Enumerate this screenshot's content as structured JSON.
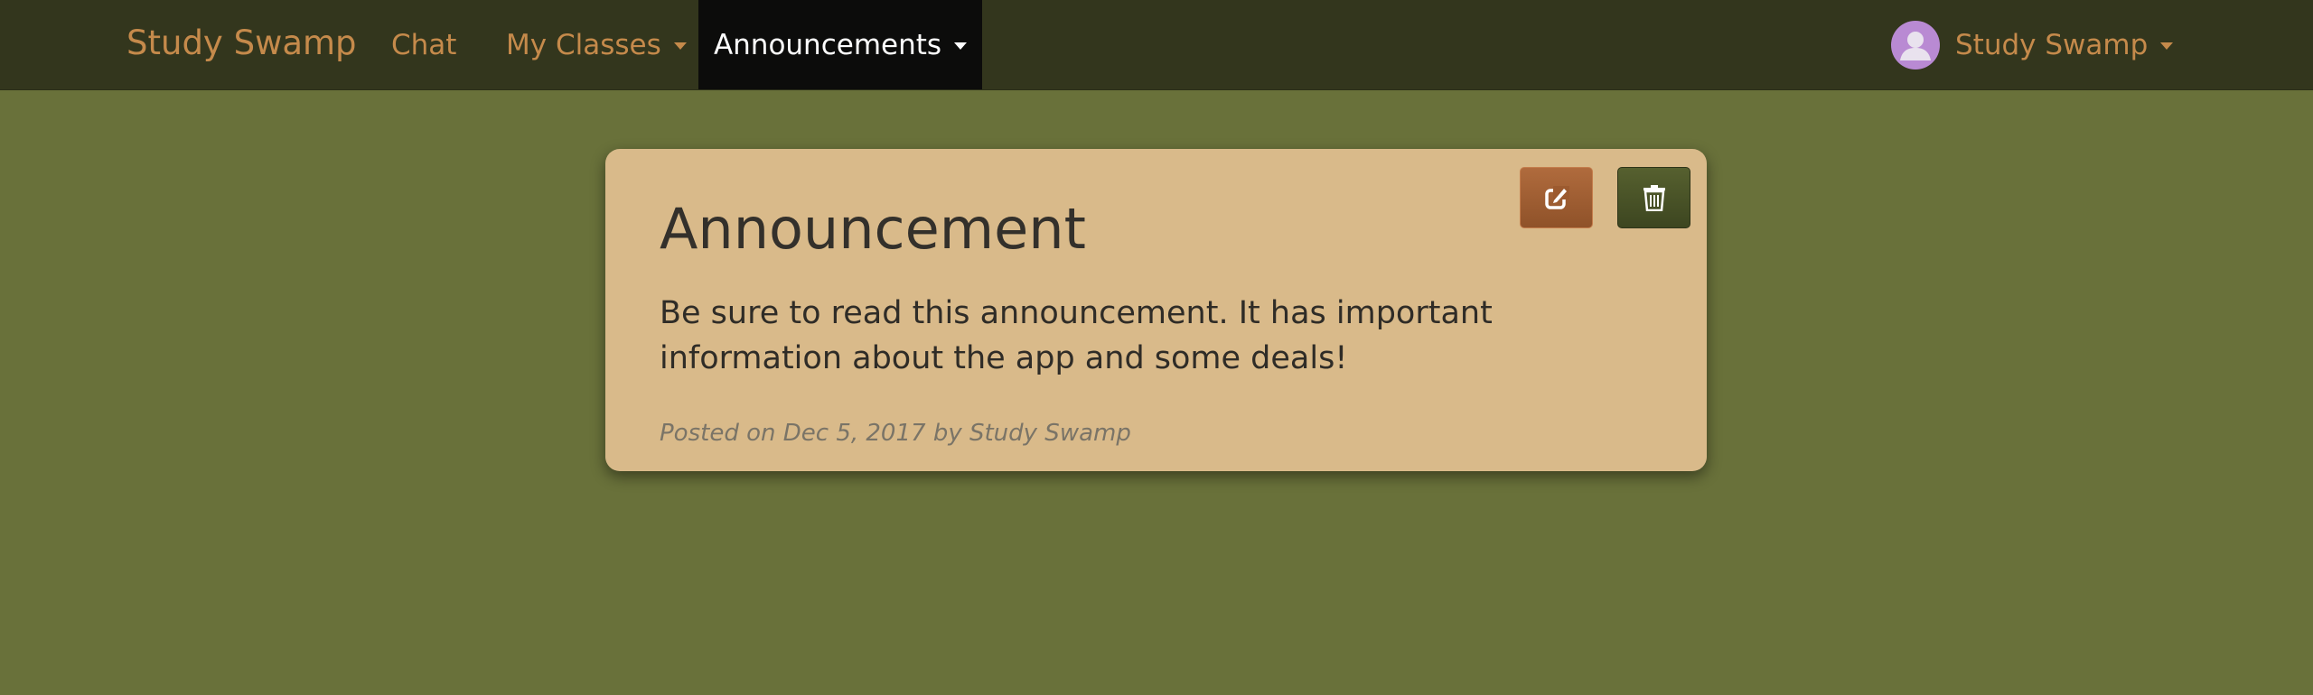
{
  "navbar": {
    "brand": "Study Swamp",
    "items": [
      {
        "label": "Chat"
      },
      {
        "label": "My Classes"
      },
      {
        "label": "Announcements"
      }
    ],
    "user": {
      "name": "Study Swamp",
      "avatar_icon": "user-avatar-icon"
    }
  },
  "announcement": {
    "title": "Announcement",
    "body": "Be sure to read this announcement. It has important information about the app and some deals!",
    "meta": "Posted on Dec 5, 2017 by Study Swamp",
    "actions": {
      "edit_icon": "edit-icon",
      "delete_icon": "trash-icon"
    }
  },
  "colors": {
    "page_bg": "#69713a",
    "navbar_bg": "#33361d",
    "active_nav_bg": "#0c0c0b",
    "accent": "#c58a4b",
    "card_bg": "#d9ba8a",
    "edit_button": "#a25f33",
    "delete_button": "#4a5327",
    "avatar_bg": "#b98ad3"
  }
}
